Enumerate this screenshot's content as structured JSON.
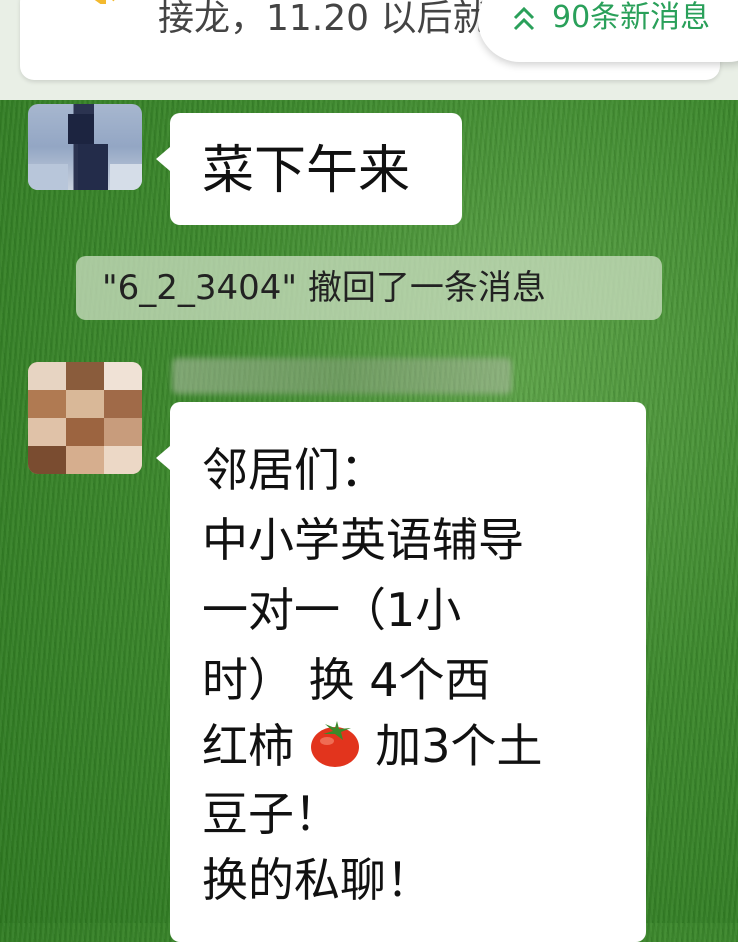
{
  "announcement": {
    "text": "接龙，11.20 以后就",
    "icon": "speaker-icon"
  },
  "new_messages": {
    "label": "90条新消息",
    "icon": "double-chevron-up-icon",
    "color": "#2aa05a"
  },
  "messages": [
    {
      "type": "text",
      "avatar": "pixelated-avatar",
      "text": "菜下午来"
    },
    {
      "type": "system",
      "text": "\"6_2_3404\" 撤回了一条消息"
    },
    {
      "type": "text",
      "avatar": "pixelated-avatar",
      "sender_name": "",
      "lines": [
        "邻居们：",
        "中小学英语辅导",
        "一对一（1小",
        "时）  换  4个西",
        "红柿",
        "加3个土",
        "豆子！",
        "换的私聊！"
      ],
      "inline_icon": "tomato-emoji-icon"
    }
  ],
  "colors": {
    "wallpaper": "#3e8a2e",
    "bubble": "#ffffff",
    "system_notice_bg": "#c8dcbe",
    "accent_green": "#2aa05a"
  }
}
